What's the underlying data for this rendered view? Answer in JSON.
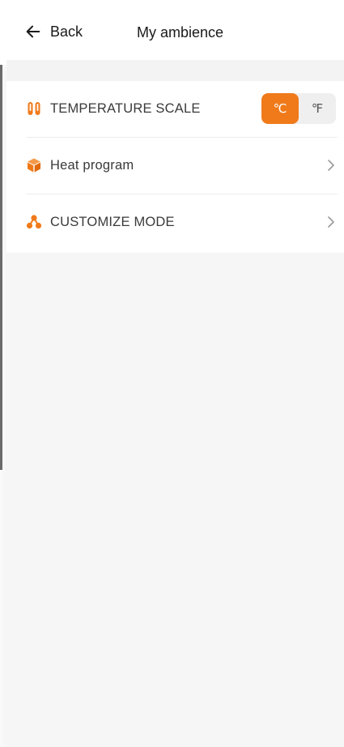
{
  "header": {
    "back_label": "Back",
    "title": "My ambience"
  },
  "settings": {
    "temperature_scale": {
      "label": "TEMPERATURE SCALE",
      "options": [
        "℃",
        "℉"
      ],
      "selected": "℃"
    },
    "heat_program": {
      "label": "Heat program"
    },
    "customize_mode": {
      "label": "CUSTOMIZE MODE"
    }
  },
  "colors": {
    "accent": "#f07a1a"
  },
  "icons": {
    "back": "arrow-left-icon",
    "temperature": "thermometer-pair-icon",
    "heat_program": "cube-icon",
    "customize_mode": "nodes-icon",
    "chevron": "chevron-right-icon"
  }
}
